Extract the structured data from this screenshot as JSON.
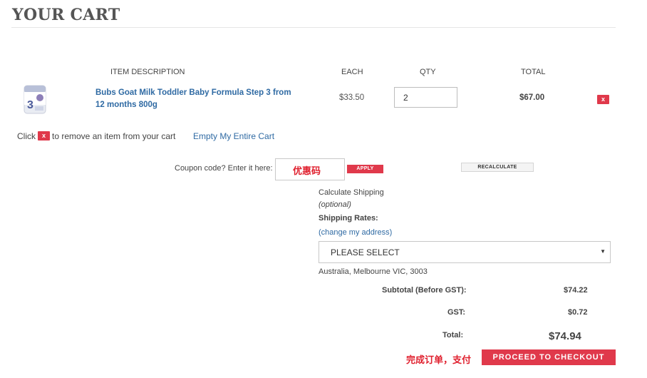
{
  "page": {
    "title": "YOUR CART"
  },
  "table": {
    "headers": {
      "item_description": "ITEM DESCRIPTION",
      "each": "EACH",
      "qty": "QTY",
      "total": "TOTAL"
    },
    "rows": [
      {
        "product_name": "Bubs Goat Milk Toddler Baby Formula Step 3 from 12 months 800g",
        "each": "$33.50",
        "qty": "2",
        "total": "$67.00",
        "remove_label": "x"
      }
    ]
  },
  "remove_hint": {
    "prefix": "Click",
    "icon_label": "x",
    "suffix": "to remove an item from your cart"
  },
  "empty_cart_link": "Empty My Entire Cart",
  "coupon": {
    "label": "Coupon code? Enter it here:",
    "value": "优惠码",
    "apply_label": "APPLY"
  },
  "recalculate_label": "RECALCULATE",
  "shipping": {
    "calculate_label": "Calculate Shipping",
    "optional_label": "(optional)",
    "rates_label": "Shipping Rates:",
    "change_address_link": "(change my address)",
    "select_value": "PLEASE SELECT",
    "address": "Australia, Melbourne VIC, 3003"
  },
  "summary": {
    "subtotal_label": "Subtotal (Before GST):",
    "subtotal_value": "$74.22",
    "gst_label": "GST:",
    "gst_value": "$0.72",
    "total_label": "Total:",
    "total_value": "$74.94"
  },
  "checkout": {
    "note": "完成订单，支付",
    "button_label": "PROCEED TO CHECKOUT"
  },
  "colors": {
    "accent": "#e0394b",
    "link": "#2f6aa3",
    "annotation": "#e0202e"
  }
}
